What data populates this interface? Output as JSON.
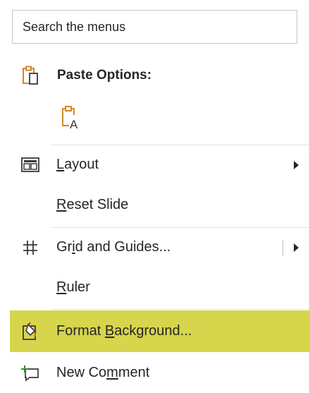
{
  "search": {
    "placeholder": "Search the menus"
  },
  "paste_options": {
    "label": "Paste Options:"
  },
  "items": {
    "layout": {
      "pre": "",
      "key": "L",
      "post": "ayout"
    },
    "reset": {
      "pre": "",
      "key": "R",
      "post": "eset Slide"
    },
    "grid": {
      "pre": "Gr",
      "key": "i",
      "post": "d and Guides..."
    },
    "ruler": {
      "pre": "",
      "key": "R",
      "post": "uler"
    },
    "format_bg": {
      "pre": "Format ",
      "key": "B",
      "post": "ackground..."
    },
    "comment": {
      "pre": "New Co",
      "key": "m",
      "post": "ment"
    }
  },
  "colors": {
    "highlight": "#d7d54c",
    "icon_orange": "#d08a28",
    "icon_green": "#2e8b3a"
  },
  "icons": {
    "paste": "clipboard-icon",
    "paste_keep_text": "clipboard-text-icon",
    "layout": "layout-icon",
    "grid": "grid-icon",
    "format_bg": "format-background-icon",
    "comment": "new-comment-icon"
  }
}
